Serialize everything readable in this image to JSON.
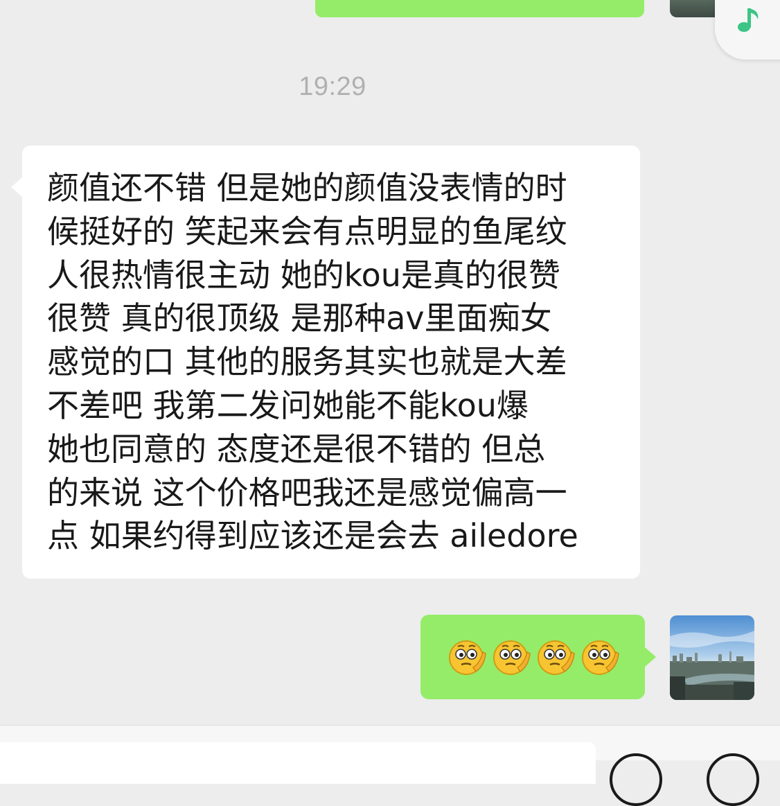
{
  "chat": {
    "timestamp": "19:29",
    "incoming_message": "颜值还不错 但是她的颜值没表情的时\n候挺好的 笑起来会有点明显的鱼尾纹\n人很热情很主动 她的kou是真的很赞\n很赞 真的很顶级 是那种av里面痴女\n感觉的口 其他的服务其实也就是大差\n不差吧 我第二发问她能不能kou爆\n她也同意的 态度还是很不错的 但总\n的来说 这个价格吧我还是感觉偏高一\n点 如果约得到应该还是会去 ailedore",
    "outgoing_emojis": [
      "thinking-face-emoji",
      "thinking-face-emoji",
      "thinking-face-emoji",
      "thinking-face-emoji"
    ]
  },
  "floating_widget": {
    "icon": "music-note-icon"
  },
  "colors": {
    "background": "#ededed",
    "incoming_bubble": "#ffffff",
    "outgoing_bubble": "#95ec69",
    "timestamp": "#b0b0b0",
    "music_icon": "#3cc585"
  }
}
